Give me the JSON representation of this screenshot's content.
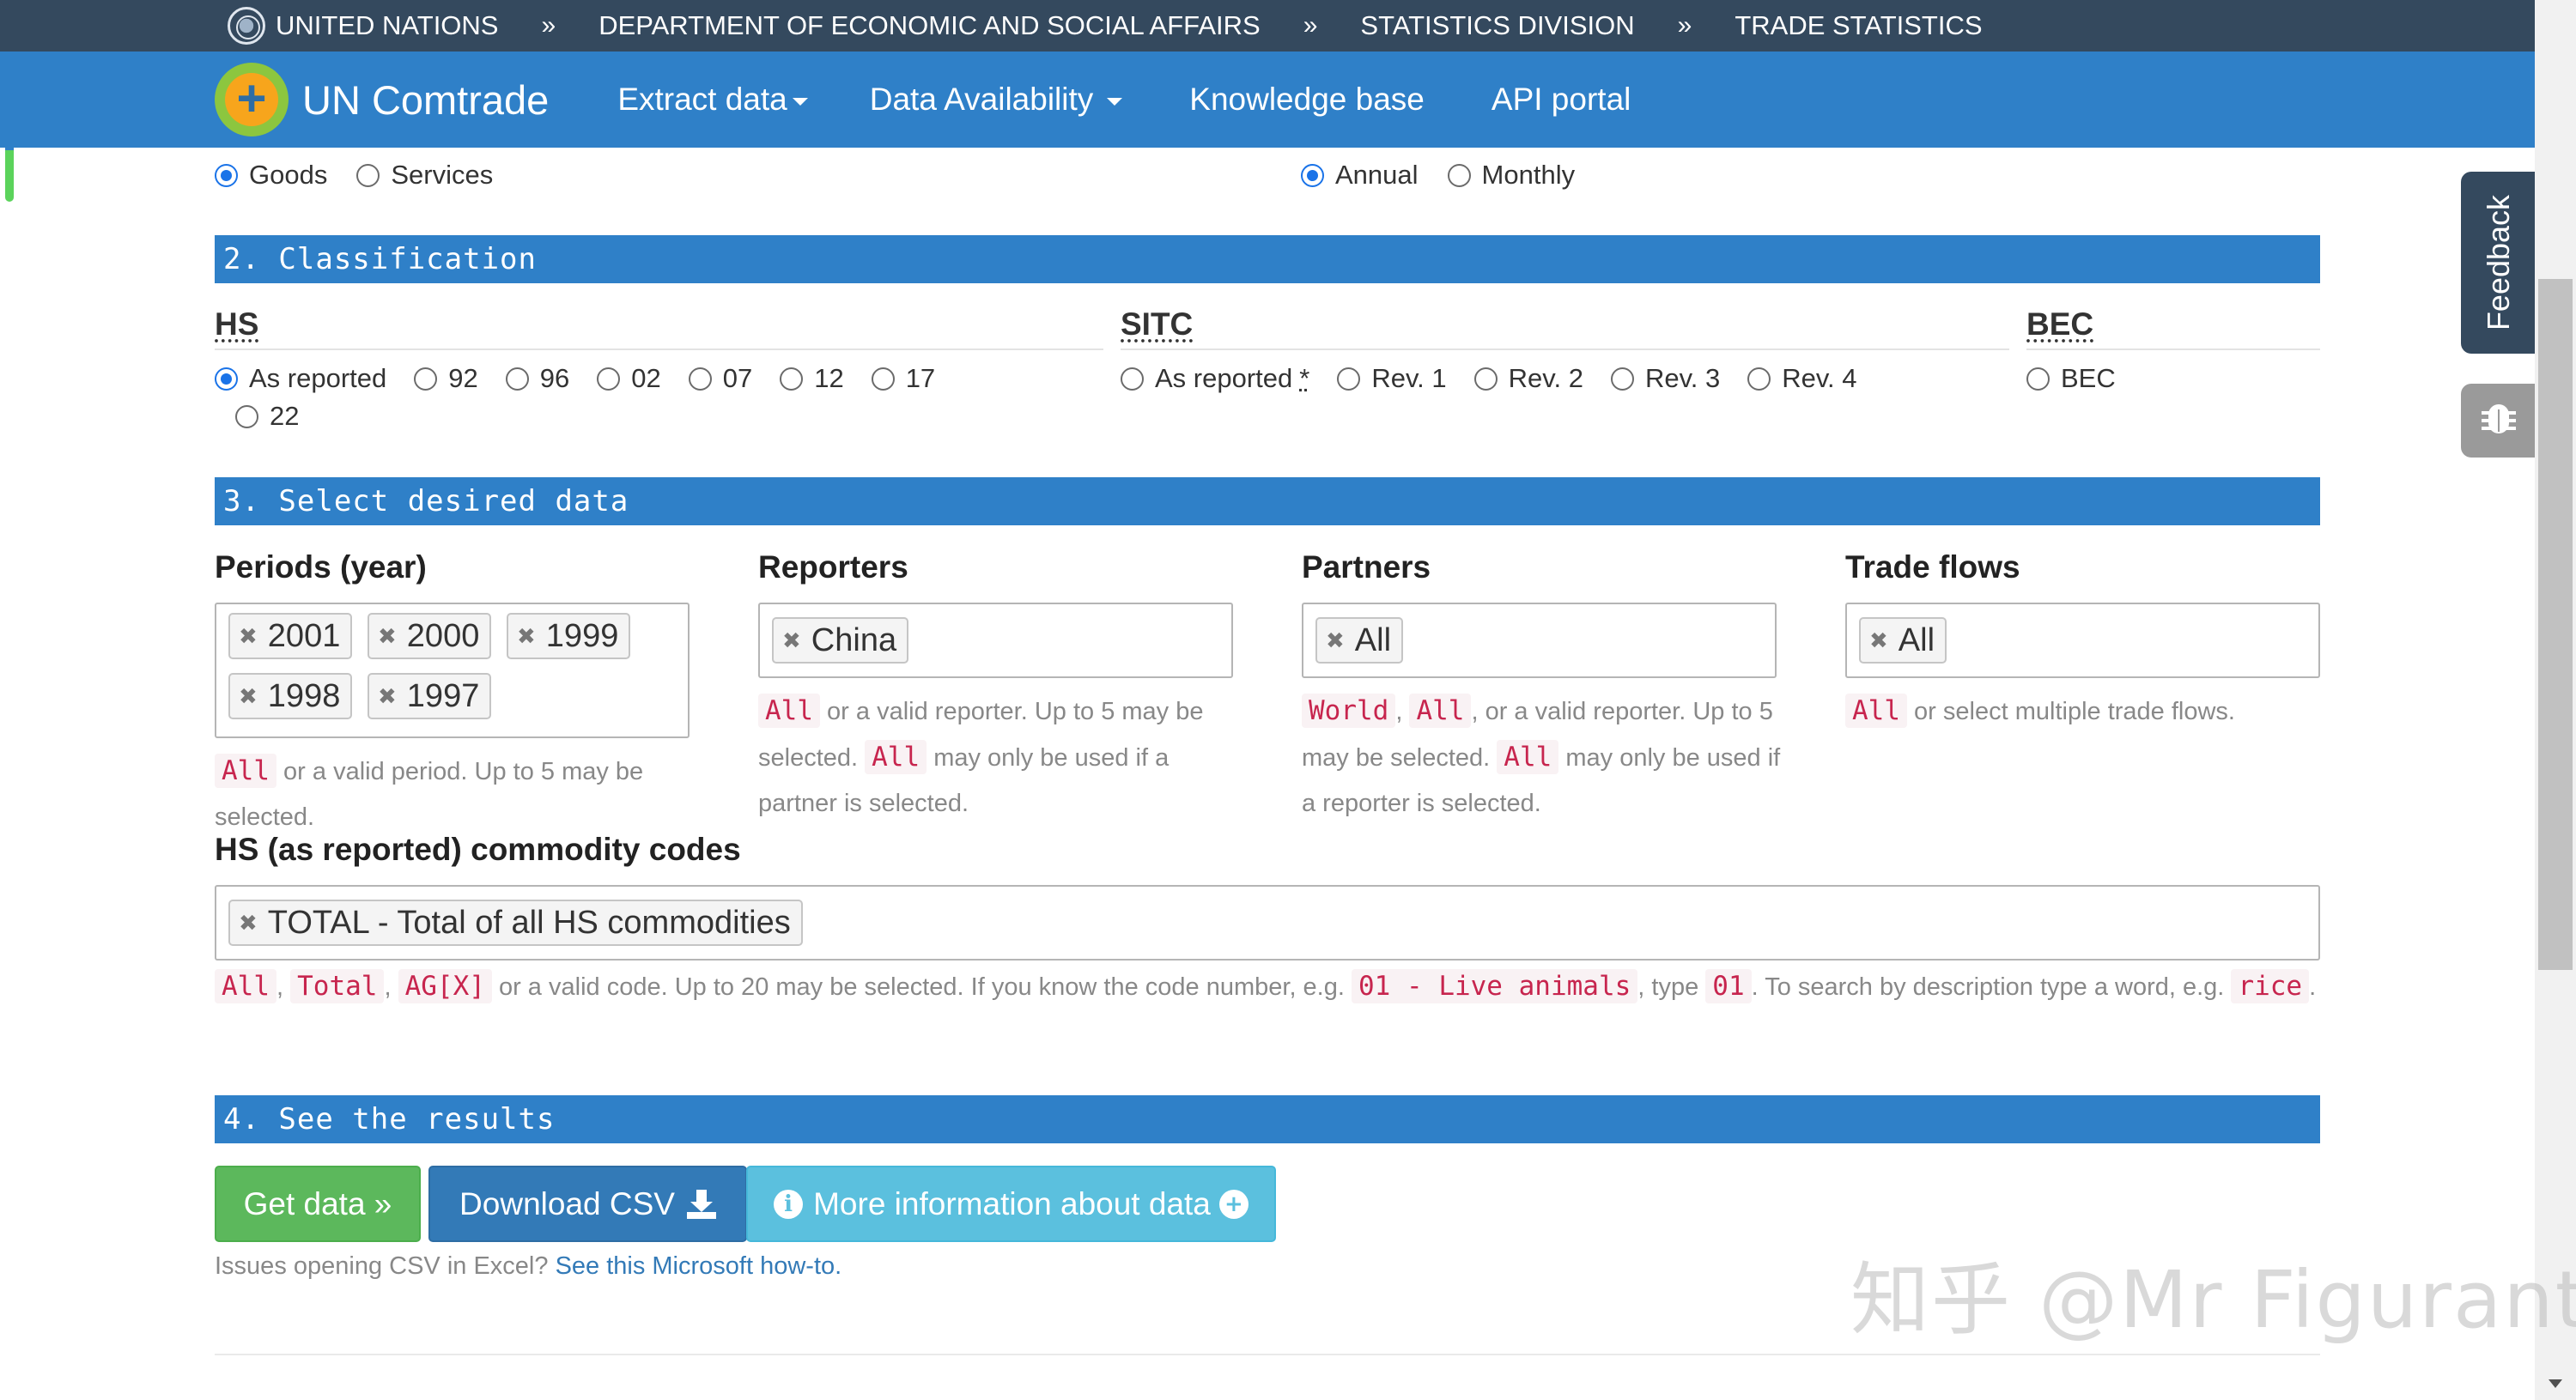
{
  "top_bar": {
    "crumbs": [
      "UNITED NATIONS",
      "DEPARTMENT OF ECONOMIC AND SOCIAL AFFAIRS",
      "STATISTICS DIVISION",
      "TRADE STATISTICS"
    ],
    "separator": "»"
  },
  "navbar": {
    "brand": "UN Comtrade",
    "items": [
      "Extract data",
      "Data Availability",
      "Knowledge base",
      "API portal"
    ]
  },
  "type_options": [
    "Goods",
    "Services"
  ],
  "frequency_options": [
    "Annual",
    "Monthly"
  ],
  "classification": {
    "heading": "2.  Classification",
    "hs": {
      "title": "HS",
      "options": [
        "As reported",
        "92",
        "96",
        "02",
        "07",
        "12",
        "17",
        "22"
      ]
    },
    "sitc": {
      "title": "SITC",
      "options": [
        "As reported",
        "Rev. 1",
        "Rev. 2",
        "Rev. 3",
        "Rev. 4"
      ],
      "asterisk": "*"
    },
    "bec": {
      "title": "BEC",
      "options": [
        "BEC"
      ]
    }
  },
  "select_data": {
    "heading": "3.  Select desired data",
    "periods": {
      "label": "Periods (year)",
      "tags": [
        "2001",
        "2000",
        "1999",
        "1998",
        "1997"
      ],
      "help_code": "All",
      "help_text": " or a valid period. Up to 5 may be selected."
    },
    "reporters": {
      "label": "Reporters",
      "tags": [
        "China"
      ],
      "help_code_1": "All",
      "help_text_1": " or a valid reporter. Up to 5 may be selected. ",
      "help_code_2": "All",
      "help_text_2": " may only be used if a partner is selected."
    },
    "partners": {
      "label": "Partners",
      "tags": [
        "All"
      ],
      "help_code_1": "World",
      "help_sep": ", ",
      "help_code_2": "All",
      "help_text_1": ", or a valid reporter. Up to 5 may be selected. ",
      "help_code_3": "All",
      "help_text_2": " may only be used if a reporter is selected."
    },
    "trade_flows": {
      "label": "Trade flows",
      "tags": [
        "All"
      ],
      "help_code": "All",
      "help_text": " or select multiple trade flows."
    },
    "commodity": {
      "label": "HS (as reported) commodity codes",
      "tags": [
        "TOTAL - Total of all HS commodities"
      ],
      "codes": [
        "All",
        "Total",
        "AG[X]",
        "01 - Live animals",
        "01",
        "rice"
      ],
      "text_1": ", ",
      "text_2": ", ",
      "text_3": " or a valid code. Up to 20 may be selected. If you know the code number, e.g. ",
      "text_4": ", type ",
      "text_5": ". To search by description type a word, e.g. ",
      "text_6": "."
    }
  },
  "results": {
    "heading": "4.  See the results",
    "get_data": "Get data »",
    "download_csv": "Download CSV",
    "more_info": "More information about data",
    "note_text": "Issues opening CSV in Excel? ",
    "note_link": "See this Microsoft how-to."
  },
  "side": {
    "feedback": "Feedback"
  },
  "watermark": "知乎 @Mr Figurant",
  "icons": [
    "un-emblem-icon",
    "comtrade-logo-icon",
    "caret-down-icon",
    "remove-tag-icon",
    "download-icon",
    "info-circle-icon",
    "plus-circle-icon",
    "bug-icon",
    "scroll-down-arrow-icon"
  ],
  "colors": {
    "nav_blue": "#2f80c8",
    "top_bar": "#34495e",
    "green_button": "#5cb85c",
    "blue_button": "#337ab7",
    "info_button": "#5bc0de",
    "code_red": "#c7254e"
  }
}
